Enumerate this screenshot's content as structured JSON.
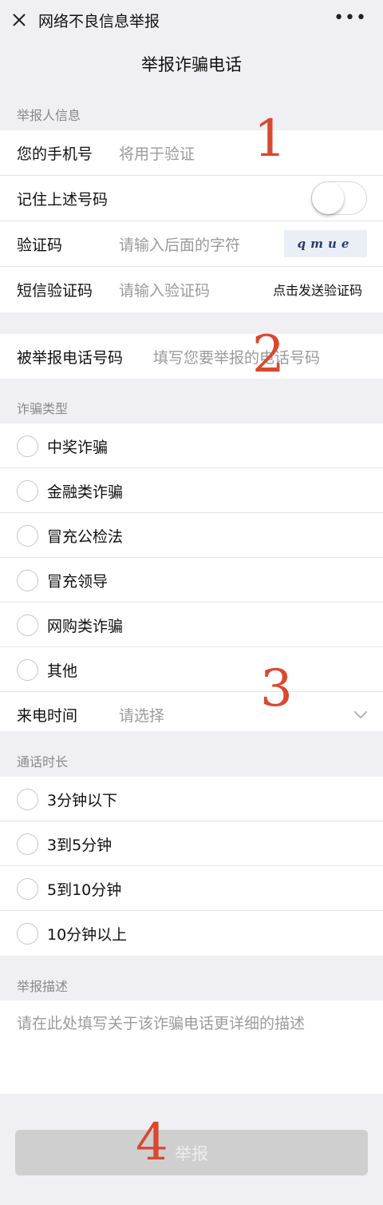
{
  "header": {
    "title": "网络不良信息举报",
    "close_icon": "close-icon",
    "more_label": "•••"
  },
  "page_title": "举报诈骗电话",
  "reporter": {
    "section_label": "举报人信息",
    "phone_label": "您的手机号",
    "phone_placeholder": "将用于验证",
    "remember_label": "记住上述号码",
    "remember_on": false,
    "captcha_label": "验证码",
    "captcha_placeholder": "请输入后面的字符",
    "captcha_text": "qmue",
    "sms_label": "短信验证码",
    "sms_placeholder": "请输入验证码",
    "sms_button": "点击发送验证码"
  },
  "reported": {
    "label": "被举报电话号码",
    "placeholder": "填写您要举报的电话号码"
  },
  "fraud_type": {
    "section_label": "诈骗类型",
    "options": [
      "中奖诈骗",
      "金融类诈骗",
      "冒充公检法",
      "冒充领导",
      "网购类诈骗",
      "其他"
    ]
  },
  "call_time": {
    "label": "来电时间",
    "placeholder": "请选择"
  },
  "call_duration": {
    "section_label": "通话时长",
    "options": [
      "3分钟以下",
      "3到5分钟",
      "5到10分钟",
      "10分钟以上"
    ]
  },
  "description": {
    "section_label": "举报描述",
    "placeholder": "请在此处填写关于该诈骗电话更详细的描述"
  },
  "submit_label": "举报",
  "annotations": [
    "1",
    "2",
    "3",
    "4"
  ],
  "colors": {
    "annotation": "#d9482f",
    "submit_bg": "#cfcfcf",
    "page_bg": "#efeff4"
  }
}
